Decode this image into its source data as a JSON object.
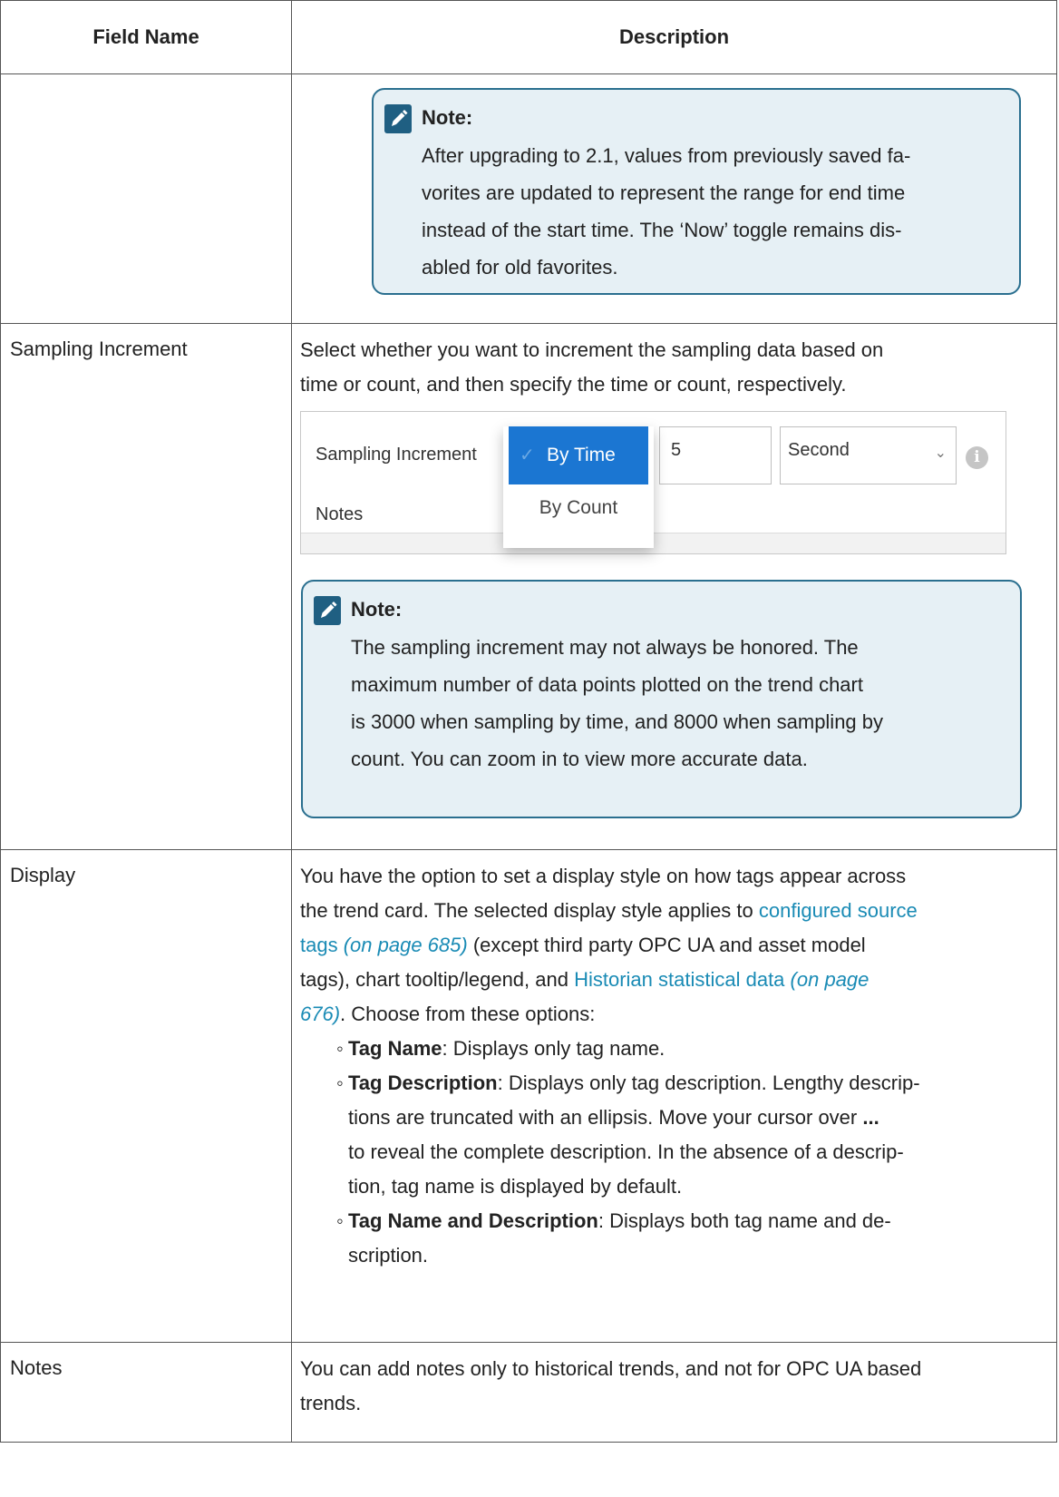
{
  "table": {
    "header_field": "Field Name",
    "header_desc": "Description"
  },
  "note_label": "Note:",
  "row0": {
    "note": "After upgrading to 2.1, values from previously saved fa-vorites are updated to represent the range for end time instead of the start time. The ‘Now’ toggle remains dis-abled for old favorites.",
    "note_lines": [
      "After upgrading to 2.1, values from previously saved fa-",
      "vorites are updated to represent the range for end time",
      "instead of the start time. The ‘Now’ toggle remains dis-",
      "abled for old favorites."
    ]
  },
  "row1": {
    "field": "Sampling Increment",
    "desc_lines": [
      "Select whether you want to increment the sampling data based on",
      "time or count, and then specify the time or count, respectively."
    ],
    "widget": {
      "label": "Sampling Increment",
      "notes_label": "Notes",
      "options": [
        "By Time",
        "By Count"
      ],
      "selected": "By Time",
      "value": "5",
      "unit": "Second",
      "accent": "#1b76d2"
    },
    "note_lines": [
      "The sampling increment may not always be honored. The",
      "maximum number of data points plotted on the trend chart",
      "is 3000 when sampling by time, and 8000 when sampling by",
      "count. You can zoom in to view more accurate data."
    ]
  },
  "row2": {
    "field": "Display",
    "l1": "You have the option to set a display style on how tags appear across",
    "l2_pre": "the trend card. The selected display style applies to ",
    "link1_a": "configured source",
    "link1_b": "tags",
    "link1_page": "(on page 685)",
    "l3_post": " (except third party OPC UA and asset model",
    "l4_pre": "tags), chart tooltip/legend, and ",
    "link2": "Historian statistical data",
    "link2_page_a": "(on page",
    "link2_page_b": "676)",
    "l5_post": ". Choose from these options:",
    "options": [
      {
        "name": "Tag Name",
        "lines": [
          ": Displays only tag name."
        ]
      },
      {
        "name": "Tag Description",
        "lines": [
          ": Displays only tag description. Lengthy descrip-",
          "tions are truncated with an ellipsis. Move your cursor over ",
          "to reveal the complete description. In the absence of a descrip-",
          "tion, tag name is displayed by default."
        ],
        "ellipsis": "..."
      },
      {
        "name": "Tag Name and Description",
        "lines": [
          ": Displays both tag name and de-",
          "scription."
        ]
      }
    ]
  },
  "row3": {
    "field": "Notes",
    "desc_lines": [
      "You can add notes only to historical trends, and not for OPC UA based",
      "trends."
    ]
  },
  "colors": {
    "link": "#1a8bb5",
    "note_bg": "#e6f0f5",
    "note_border": "#2a6f8f",
    "note_icon": "#1f5f82"
  }
}
